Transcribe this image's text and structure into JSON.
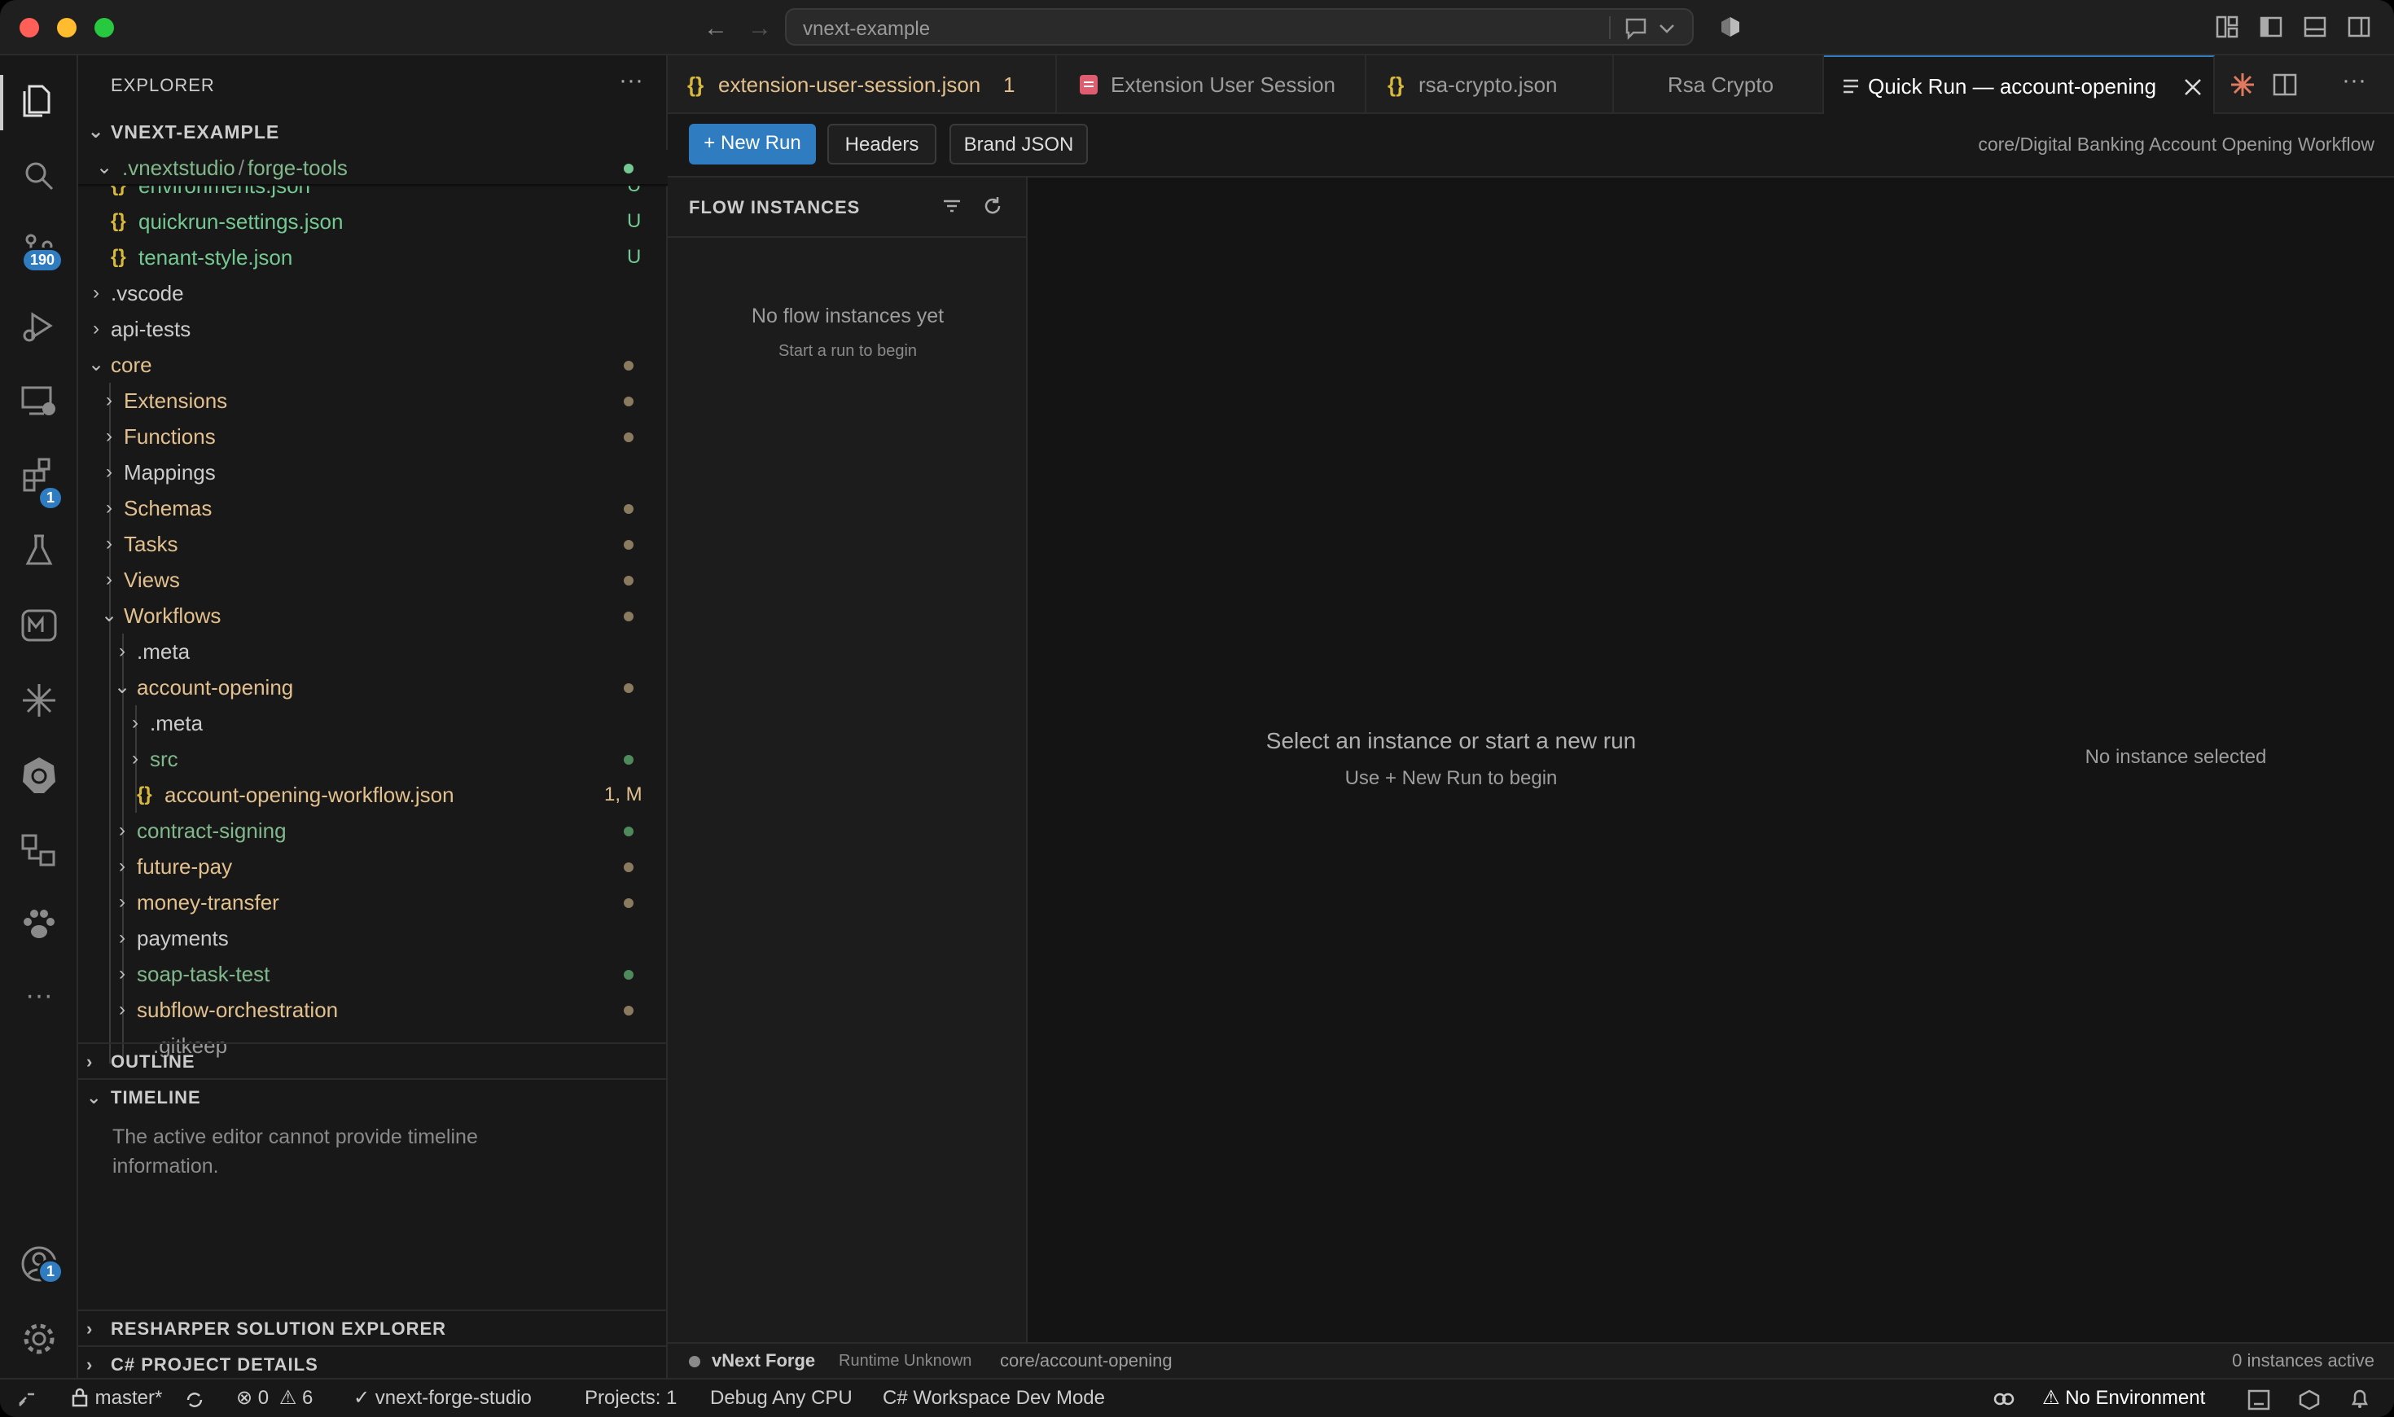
{
  "titlebar": {
    "search_text": "vnext-example"
  },
  "activity": {
    "source_control_badge": "190",
    "extensions_badge": "1",
    "accounts_badge": "1"
  },
  "explorer": {
    "title": "EXPLORER",
    "root": "VNEXT-EXAMPLE",
    "path_part1": ".vnextstudio",
    "path_sep": "/",
    "path_part2": "forge-tools",
    "rows": [
      {
        "label": "environments.json",
        "status": "U"
      },
      {
        "label": "quickrun-settings.json",
        "status": "U"
      },
      {
        "label": "tenant-style.json",
        "status": "U"
      },
      {
        "label": ".vscode"
      },
      {
        "label": "api-tests"
      },
      {
        "label": "core"
      },
      {
        "label": "Extensions"
      },
      {
        "label": "Functions"
      },
      {
        "label": "Mappings"
      },
      {
        "label": "Schemas"
      },
      {
        "label": "Tasks"
      },
      {
        "label": "Views"
      },
      {
        "label": "Workflows"
      },
      {
        "label": ".meta"
      },
      {
        "label": "account-opening"
      },
      {
        "label": ".meta"
      },
      {
        "label": "src"
      },
      {
        "label": "account-opening-workflow.json",
        "status": "1, M"
      },
      {
        "label": "contract-signing"
      },
      {
        "label": "future-pay"
      },
      {
        "label": "money-transfer"
      },
      {
        "label": "payments"
      },
      {
        "label": "soap-task-test"
      },
      {
        "label": "subflow-orchestration"
      },
      {
        "label": ".gitkeep"
      }
    ],
    "outline": "OUTLINE",
    "timeline": "TIMELINE",
    "timeline_msg1": "The active editor cannot provide timeline",
    "timeline_msg2": "information.",
    "resharper": "RESHARPER SOLUTION EXPLORER",
    "csharp": "C# PROJECT DETAILS"
  },
  "tabs": [
    {
      "label": "extension-user-session.json",
      "suffix": "1"
    },
    {
      "label": "Extension User Session"
    },
    {
      "label": "rsa-crypto.json"
    },
    {
      "label": "Rsa Crypto"
    },
    {
      "label": "Quick Run — account-opening"
    }
  ],
  "toolbar": {
    "new_run": "+ New Run",
    "headers": "Headers",
    "brand_json": "Brand JSON",
    "breadcrumb": "core/Digital Banking Account Opening Workflow"
  },
  "flow": {
    "title": "FLOW INSTANCES",
    "empty": "No flow instances yet",
    "empty_sub": "Start a run to begin"
  },
  "main": {
    "center_title": "Select an instance or start a new run",
    "center_sub": "Use + New Run to begin",
    "right_empty": "No instance selected"
  },
  "panel_status": {
    "name": "vNext Forge",
    "runtime": "Runtime Unknown",
    "path": "core/account-opening",
    "active": "0 instances active"
  },
  "statusbar": {
    "branch": "master*",
    "errors": "0",
    "warnings": "6",
    "check": "vnext-forge-studio",
    "projects": "Projects: 1",
    "debug": "Debug Any CPU",
    "workspace": "C# Workspace Dev Mode",
    "environment": "No Environment"
  },
  "colors": {
    "accent": "#2f7dc0",
    "modified": "#e2c08d",
    "untracked": "#73c991",
    "folder_green": "#81b88b"
  }
}
